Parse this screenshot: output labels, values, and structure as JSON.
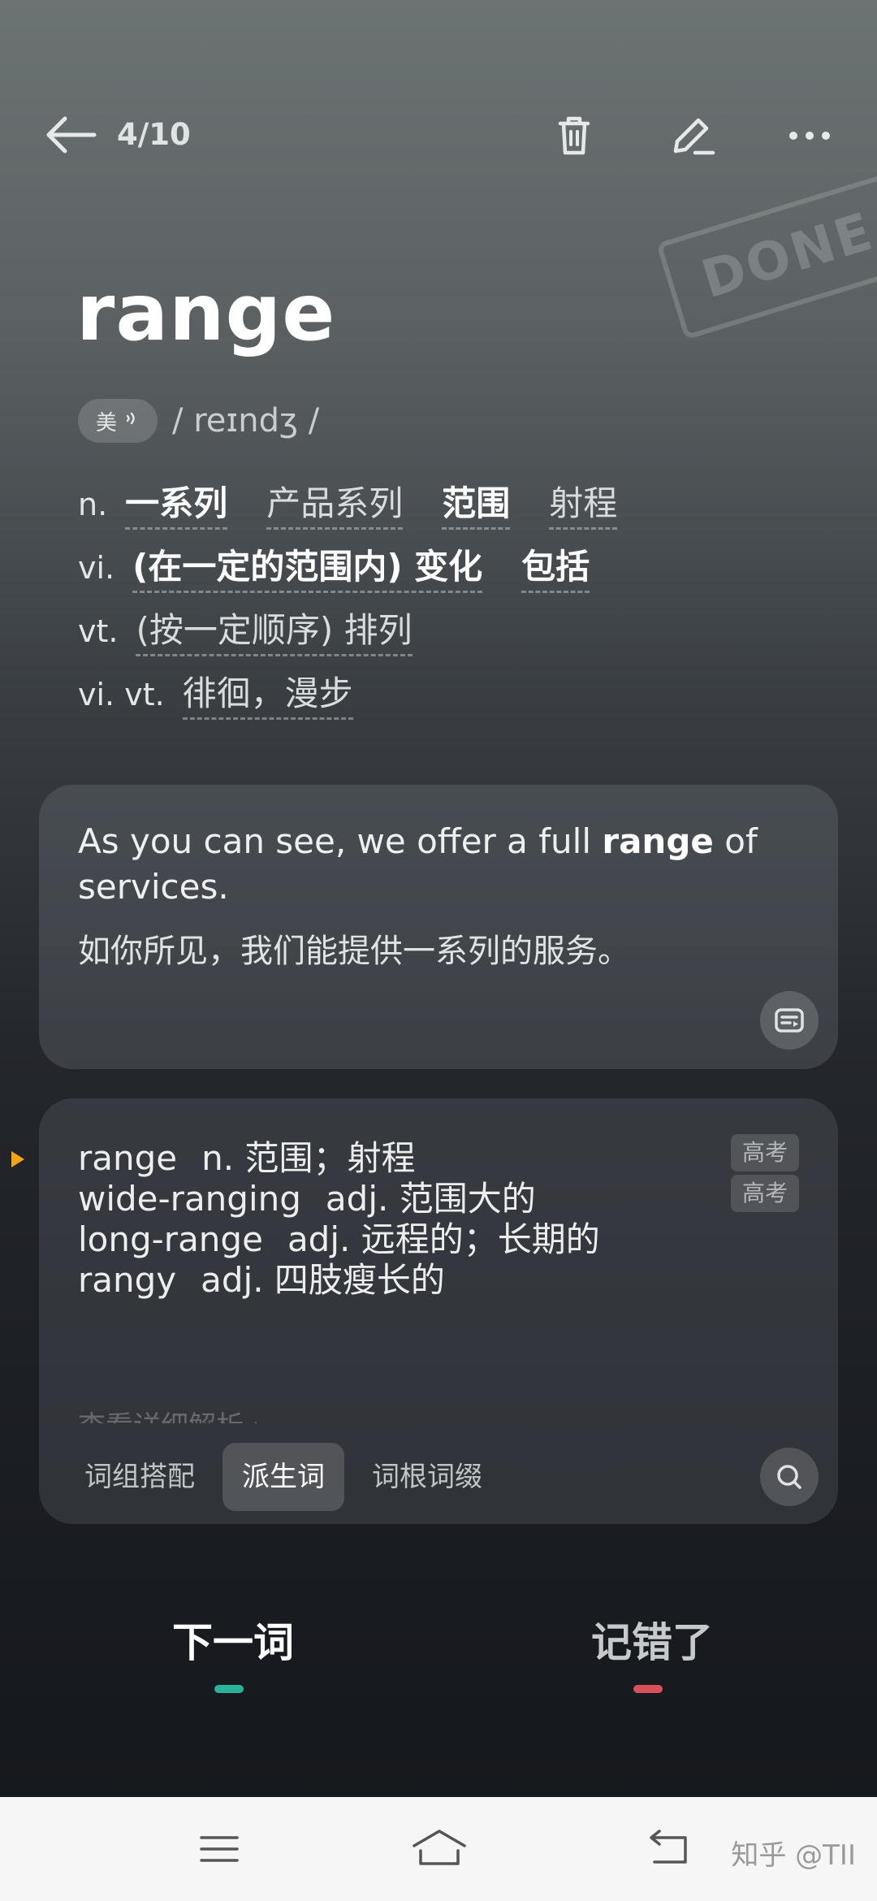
{
  "header": {
    "progress": "4/10"
  },
  "stamp": "DONE",
  "word": {
    "headword": "range",
    "accent_label": "美",
    "phonetic": "/ reɪndʒ /"
  },
  "definitions": [
    {
      "pos": "n.",
      "meanings": [
        {
          "text": "一系列",
          "bold": true
        },
        {
          "text": "产品系列",
          "bold": false
        },
        {
          "text": "范围",
          "bold": true
        },
        {
          "text": "射程",
          "bold": false
        }
      ]
    },
    {
      "pos": "vi.",
      "meanings": [
        {
          "text": "(在一定的范围内) 变化",
          "bold": true
        },
        {
          "text": "包括",
          "bold": true
        }
      ]
    },
    {
      "pos": "vt.",
      "meanings": [
        {
          "text": "(按一定顺序) 排列",
          "bold": false
        }
      ]
    },
    {
      "pos": "vi. vt.",
      "meanings": [
        {
          "text": "徘徊，漫步",
          "bold": false
        }
      ]
    }
  ],
  "example": {
    "en_before": "As you can see, we offer a full ",
    "en_keyword": "range",
    "en_after": " of services.",
    "cn": "如你所见，我们能提供一系列的服务。"
  },
  "derivatives": {
    "items": [
      {
        "word": "range",
        "meaning": "n. 范围；射程",
        "tag": "高考"
      },
      {
        "word": "wide-ranging",
        "meaning": "adj. 范围大的",
        "tag": "高考"
      },
      {
        "word": "long-range",
        "meaning": "adj. 远程的；长期的",
        "tag": ""
      },
      {
        "word": "rangy",
        "meaning": "adj. 四肢瘦长的",
        "tag": ""
      }
    ],
    "more_link": "查看详细解析 ›",
    "tabs": [
      "词组搭配",
      "派生词",
      "词根词缀"
    ],
    "active_tab": 1
  },
  "actions": {
    "next": "下一词",
    "wrong": "记错了",
    "next_color": "#2bb39a",
    "wrong_color": "#d9505a"
  },
  "navbar": {
    "watermark": "知乎 @TII"
  },
  "colors": {
    "highlight_arrow": "#f0a51a"
  }
}
